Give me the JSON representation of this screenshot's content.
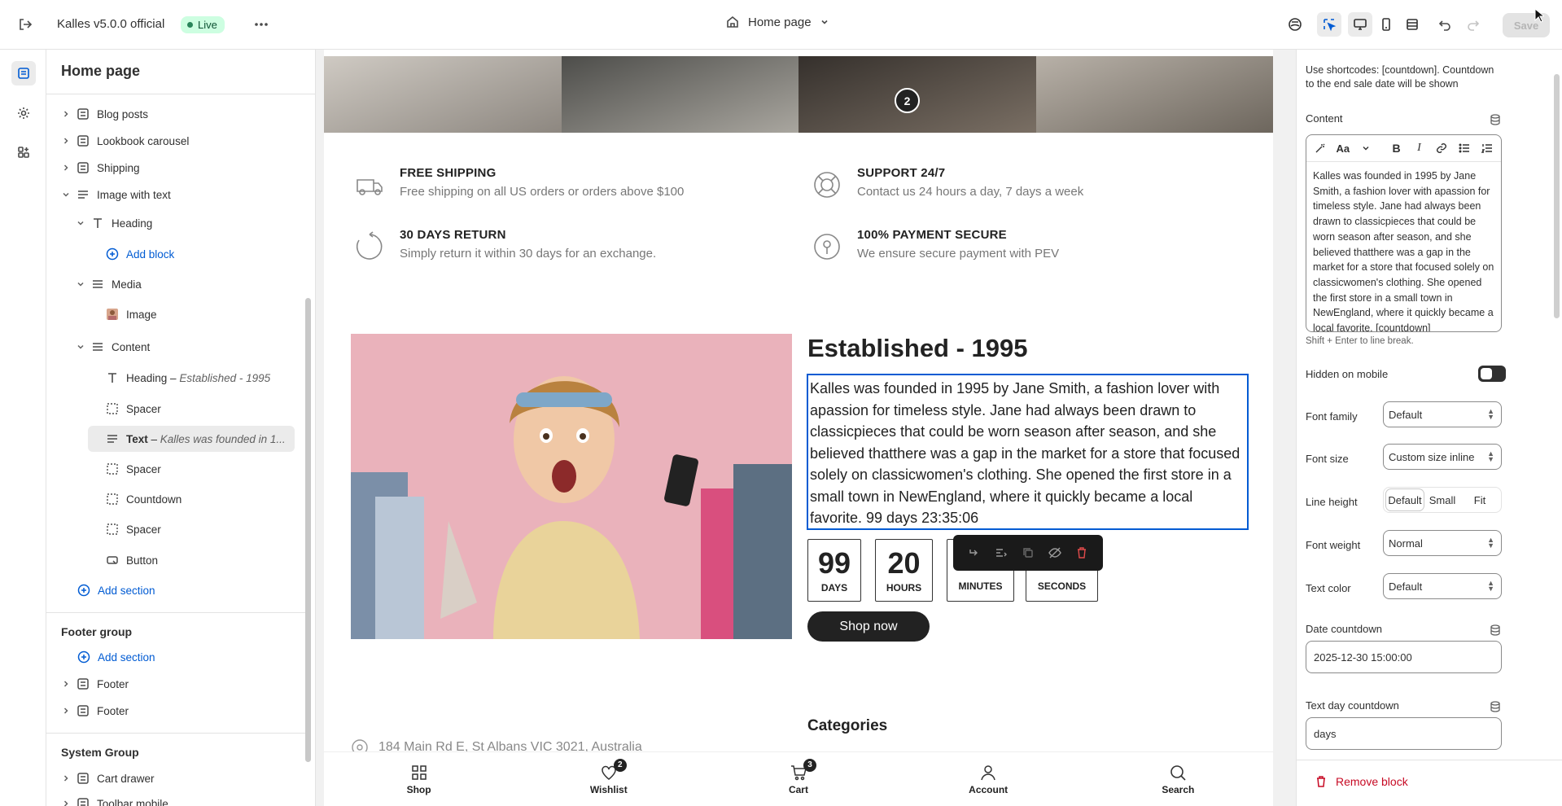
{
  "topbar": {
    "store_name": "Kalles v5.0.0 official",
    "live_badge": "Live",
    "page_selector": "Home page",
    "save_label": "Save"
  },
  "sidebar": {
    "title": "Home page",
    "rows": [
      {
        "label": "Blog posts",
        "icon": "section-icon"
      },
      {
        "label": "Lookbook carousel",
        "icon": "section-icon"
      },
      {
        "label": "Shipping",
        "icon": "section-icon"
      },
      {
        "label": "Image with text",
        "icon": "section-icon"
      },
      {
        "label": "Heading",
        "icon": "text-icon"
      },
      {
        "label": "Add block"
      },
      {
        "label": "Media",
        "icon": "group-icon"
      },
      {
        "label": "Image",
        "icon": "image-icon"
      },
      {
        "label": "Content",
        "icon": "group-icon"
      },
      {
        "label": "Heading",
        "sub": "Established - 1995",
        "icon": "text-icon"
      },
      {
        "label": "Spacer",
        "icon": "spacer-icon"
      },
      {
        "label": "Text",
        "sub": "Kalles was founded in 1...",
        "icon": "text-icon"
      },
      {
        "label": "Spacer",
        "icon": "spacer-icon"
      },
      {
        "label": "Countdown",
        "icon": "spacer-icon"
      },
      {
        "label": "Spacer",
        "icon": "spacer-icon"
      },
      {
        "label": "Button",
        "icon": "button-icon"
      },
      {
        "label": "Add section"
      }
    ],
    "footer_group": {
      "title": "Footer group",
      "add_section": "Add section",
      "items": [
        "Footer",
        "Footer"
      ]
    },
    "system_group": {
      "title": "System Group",
      "items": [
        "Cart drawer",
        "Toolbar mobile"
      ]
    }
  },
  "preview": {
    "features": [
      {
        "title": "FREE SHIPPING",
        "desc": "Free shipping on all US orders or orders above $100",
        "icon": "truck-icon"
      },
      {
        "title": "SUPPORT 24/7",
        "desc": "Contact us 24 hours a day, 7 days a week",
        "icon": "lifebuoy-icon"
      },
      {
        "title": "30 DAYS RETURN",
        "desc": "Simply return it within 30 days for an exchange.",
        "icon": "return-icon"
      },
      {
        "title": "100% PAYMENT SECURE",
        "desc": "We ensure secure payment with PEV",
        "icon": "secure-icon"
      }
    ],
    "slide_number": "2",
    "heading": "Established - 1995",
    "text": "Kalles was founded in 1995 by Jane Smith, a fashion lover with apassion for timeless style. Jane had always been drawn to classicpieces that could be worn season after season, and she believed thatthere was a gap in the market for a store that focused solely on classicwomen's clothing. She opened the first store in a small town in NewEngland, where it quickly became a local favorite. 99 days 23:35:06",
    "countdown": [
      {
        "value": "99",
        "label": "DAYS"
      },
      {
        "value": "20",
        "label": "HOURS"
      },
      {
        "value": "",
        "label": "MINUTES"
      },
      {
        "value": "",
        "label": "SECONDS"
      }
    ],
    "button": "Shop now",
    "categories_title": "Categories",
    "address": "184 Main Rd E, St Albans VIC 3021, Australia",
    "bottom_nav": [
      {
        "label": "Shop",
        "badge": ""
      },
      {
        "label": "Wishlist",
        "badge": "2"
      },
      {
        "label": "Cart",
        "badge": "3"
      },
      {
        "label": "Account",
        "badge": ""
      },
      {
        "label": "Search",
        "badge": ""
      }
    ]
  },
  "panel": {
    "intro": "Use shortcodes: [countdown]. Countdown to the end sale date will be shown",
    "content_label": "Content",
    "content_text": "Kalles was founded in 1995 by Jane Smith, a fashion lover with apassion for timeless style. Jane had always been drawn to classicpieces that could be worn season after season, and she believed thatthere was a gap in the market for a store that focused solely on classicwomen's clothing. She opened the first store in a small town in NewEngland, where it quickly became a local favorite. [countdown]",
    "line_break_hint": "Shift + Enter to line break.",
    "hidden_on_mobile": "Hidden on mobile",
    "font_family_label": "Font family",
    "font_family_value": "Default",
    "font_size_label": "Font size",
    "font_size_value": "Custom size inline",
    "line_height_label": "Line height",
    "line_height_options": [
      "Default",
      "Small",
      "Fit"
    ],
    "font_weight_label": "Font weight",
    "font_weight_value": "Normal",
    "text_color_label": "Text color",
    "text_color_value": "Default",
    "date_countdown_label": "Date countdown",
    "date_countdown_value": "2025-12-30 15:00:00",
    "text_day_label": "Text day countdown",
    "text_day_value": "days",
    "remove_block": "Remove block"
  },
  "colors": {
    "accent": "#005bd3",
    "live": "#cdfee1",
    "danger": "#c70a24"
  }
}
